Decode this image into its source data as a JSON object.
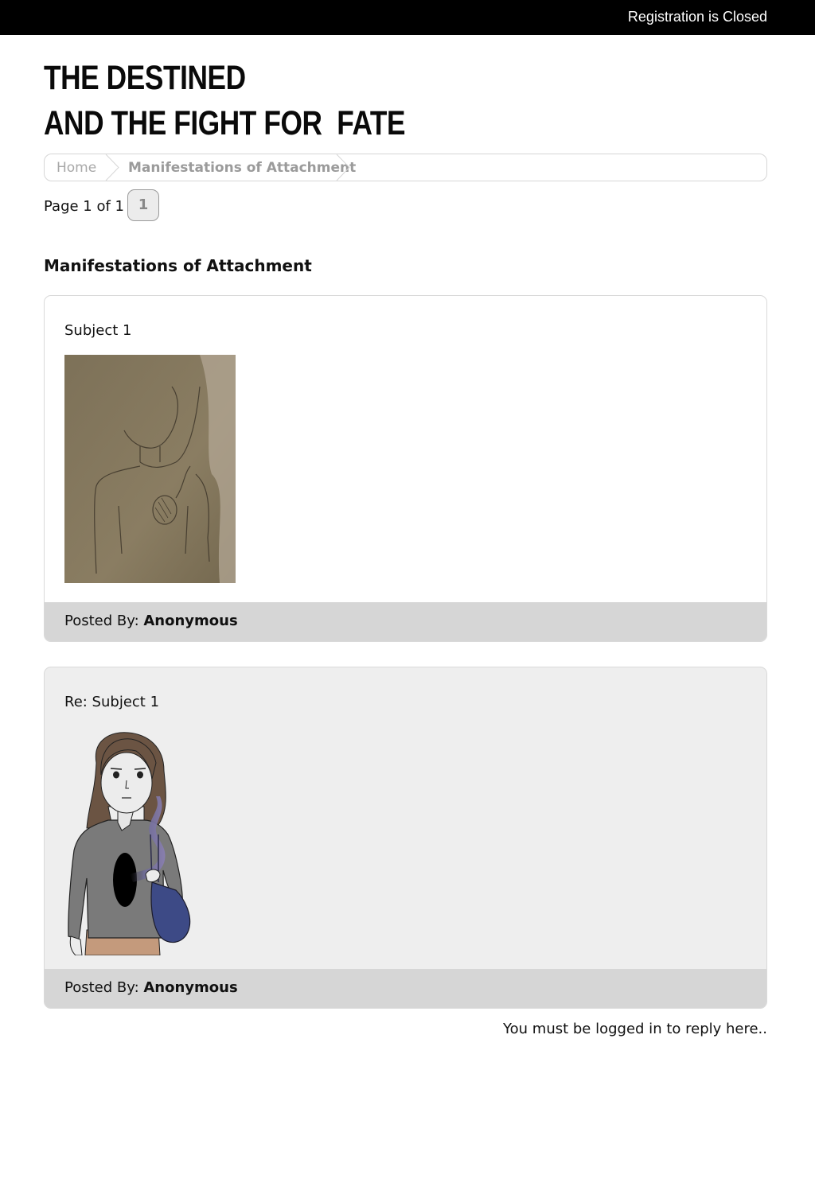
{
  "header": {
    "registration_status": "Registration is Closed",
    "site_title": "THE DESTINED\nAND THE FIGHT FOR  FATE"
  },
  "breadcrumb": {
    "home_label": "Home",
    "current_label": "Manifestations of Attachment"
  },
  "pagination": {
    "label": "Page 1 of 1",
    "pages": [
      "1"
    ]
  },
  "topic": {
    "title": "Manifestations of Attachment"
  },
  "posts": [
    {
      "subject": "Subject 1",
      "posted_by_label": "Posted By:",
      "author": "Anonymous",
      "image": "pencil-sketch-figure-with-hole-in-chest"
    },
    {
      "subject": "Re: Subject 1",
      "posted_by_label": "Posted By:",
      "author": "Anonymous",
      "image": "illustrated-woman-with-hole-and-purple-smoke"
    }
  ],
  "footer": {
    "reply_note": "You must be logged in to reply here.."
  },
  "colors": {
    "topbar": "#000000",
    "post_footer": "#d6d6d6",
    "reply_post_bg": "#eeeeee"
  }
}
